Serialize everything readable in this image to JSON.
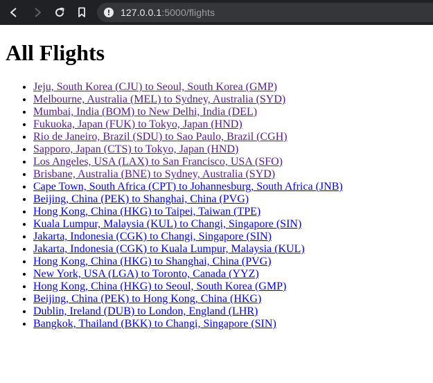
{
  "browser": {
    "url_host": "127.0.0.1",
    "url_rest": ":5000/flights",
    "icons": {
      "back": "back-arrow-icon",
      "forward": "forward-arrow-icon",
      "reload": "reload-icon",
      "bookmark": "bookmark-icon",
      "info": "info-icon"
    }
  },
  "page": {
    "title": "All Flights",
    "flights": [
      {
        "label": "Jeju, South Korea (CJU) to Seoul, South Korea (GMP)",
        "visited": true
      },
      {
        "label": "Melbourne, Australia (MEL) to Sydney, Australia (SYD)",
        "visited": true
      },
      {
        "label": "Mumbai, India (BOM) to New Delhi, India (DEL)",
        "visited": true
      },
      {
        "label": "Fukuoka, Japan (FUK) to Tokyo, Japan (HND)",
        "visited": true
      },
      {
        "label": "Rio de Janeiro, Brazil (SDU) to Sao Paulo, Brazil (CGH)",
        "visited": true
      },
      {
        "label": "Sapporo, Japan (CTS) to Tokyo, Japan (HND)",
        "visited": true
      },
      {
        "label": "Los Angeles, USA (LAX) to San Francisco, USA (SFO)",
        "visited": true
      },
      {
        "label": "Brisbane, Australia (BNE) to Sydney, Australia (SYD)",
        "visited": true
      },
      {
        "label": "Cape Town, South Africa (CPT) to Johannesburg, South Africa (JNB)",
        "visited": false
      },
      {
        "label": "Beijing, China (PEK) to Shanghai, China (PVG)",
        "visited": false
      },
      {
        "label": "Hong Kong, China (HKG) to Taipei, Taiwan (TPE)",
        "visited": false
      },
      {
        "label": "Kuala Lumpur, Malaysia (KUL) to Changi, Singapore (SIN)",
        "visited": false
      },
      {
        "label": "Jakarta, Indonesia (CGK) to Changi, Singapore (SIN)",
        "visited": false
      },
      {
        "label": "Jakarta, Indonesia (CGK) to Kuala Lumpur, Malaysia (KUL)",
        "visited": false
      },
      {
        "label": "Hong Kong, China (HKG) to Shanghai, China (PVG)",
        "visited": false
      },
      {
        "label": "New York, USA (LGA) to Toronto, Canada (YYZ)",
        "visited": false
      },
      {
        "label": "Hong Kong, China (HKG) to Seoul, South Korea (GMP)",
        "visited": false
      },
      {
        "label": "Beijing, China (PEK) to Hong Kong, China (HKG)",
        "visited": false
      },
      {
        "label": "Dublin, Ireland (DUB) to London, England (LHR)",
        "visited": false
      },
      {
        "label": "Bangkok, Thailand (BKK) to Changi, Singapore (SIN)",
        "visited": false
      }
    ]
  },
  "colors": {
    "toolbar_bg": "#202124",
    "omnibox_bg": "#35363a",
    "link": "#0000ee",
    "visited_link": "#551a8b"
  }
}
